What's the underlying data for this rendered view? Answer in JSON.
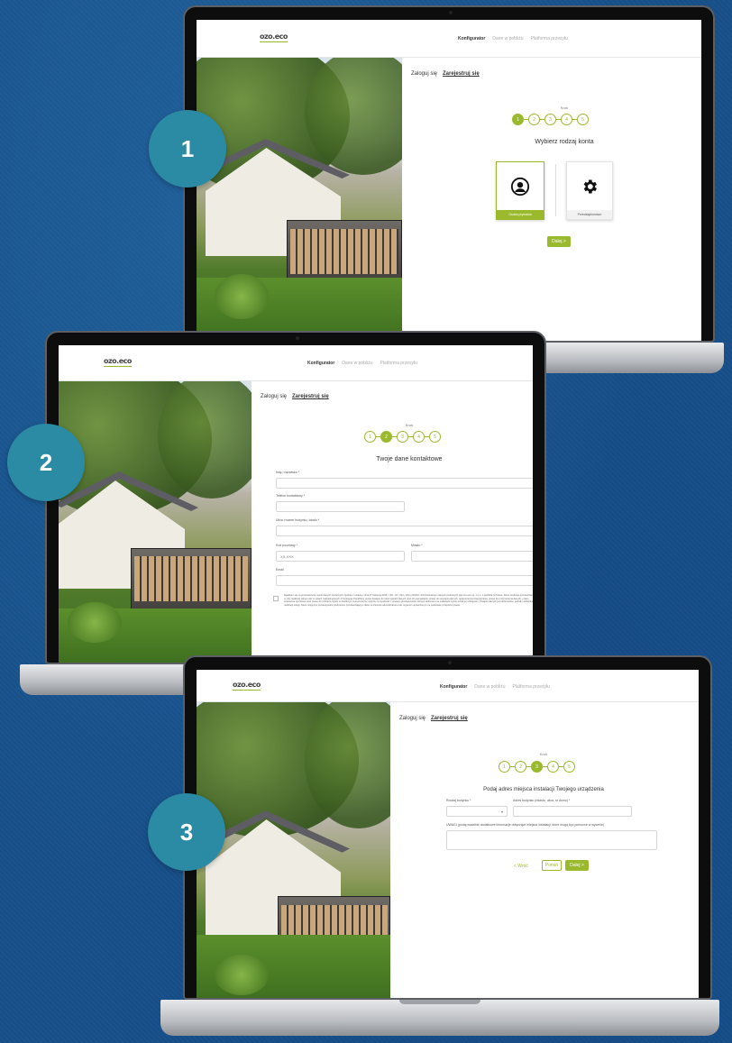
{
  "site": {
    "logo": "ozo.eco",
    "nav": [
      "Konfigurator",
      "Dane w pobliżu",
      "Platforma przesyłu"
    ],
    "auth_login": "Zaloguj się",
    "auth_register": "Zarejestruj się",
    "krok_label": "Krok",
    "accent_color": "#9bb92d"
  },
  "badges": [
    "1",
    "2",
    "3"
  ],
  "screen1": {
    "current_step": 1,
    "steps": [
      "1",
      "2",
      "3",
      "4",
      "5"
    ],
    "title": "Wybierz rodzaj konta",
    "cards": [
      {
        "label": "Osoba prywatna",
        "icon": "user-circle-icon",
        "selected": true
      },
      {
        "label": "Przedsiębiorstwo",
        "icon": "gear-icon",
        "selected": false
      }
    ],
    "next": "Dalej >"
  },
  "screen2": {
    "current_step": 2,
    "steps": [
      "1",
      "2",
      "3",
      "4",
      "5"
    ],
    "title": "Twoje dane kontaktowe",
    "fields": {
      "name": "Imię i nazwisko *",
      "phone": "Telefon kontaktowy *",
      "street": "Ulica i numer budynku, lokalu *",
      "postal": "Kod pocztowy *",
      "postal_placeholder": "XX-XXX",
      "city": "Miasto *",
      "email": "Email"
    },
    "consent": "Zgadzam się na przetwarzanie moich danych osobowych zgodnie z ustawą z dnia 27 kwietnia 2016 r. (Dz. Urz. UE L 119) o RODO. Administratorem danych osobowych jest ozo.eco sp. z o.o. z siedzibą w Polsce. Dane osobowe przetwarzane będą w celu realizacji usługi oraz w celach marketingowych. Przysługuje Pani/Panu prawo dostępu do treści swoich danych oraz ich poprawiania, prawo do usunięcia danych, ograniczenia przetwarzania, prawo do przenoszenia danych, prawo wniesienia sprzeciwu oraz prawo do cofnięcia zgody w dowolnym momencie bez wpływu na zgodność z prawem przetwarzania, którego dokonano na podstawie zgody przed jej cofnięciem. Podanie danych jest dobrowolne, jednak niezbędne do realizacji usługi. Dane mogą być przekazywane podmiotom przetwarzającym dane na zlecenie administratora oraz organom uprawnionym na podstawie przepisów prawa."
  },
  "screen3": {
    "current_step": 3,
    "steps": [
      "1",
      "2",
      "3",
      "4",
      "5"
    ],
    "title": "Podaj adres miejsca instalacji Twojego urządzenia",
    "fields": {
      "building_type": "Rodzaj budynku *",
      "address": "Adres budynku (miasto, ulica, nr domu) *",
      "notes": "UWAGI (podaj wszelkie dodatkowe informacje dotyczące miejsca instalacji, które mogą być pomocne w wycenie)"
    },
    "back": "< Wróć",
    "skip": "Pomiń",
    "next": "Dalej >"
  }
}
